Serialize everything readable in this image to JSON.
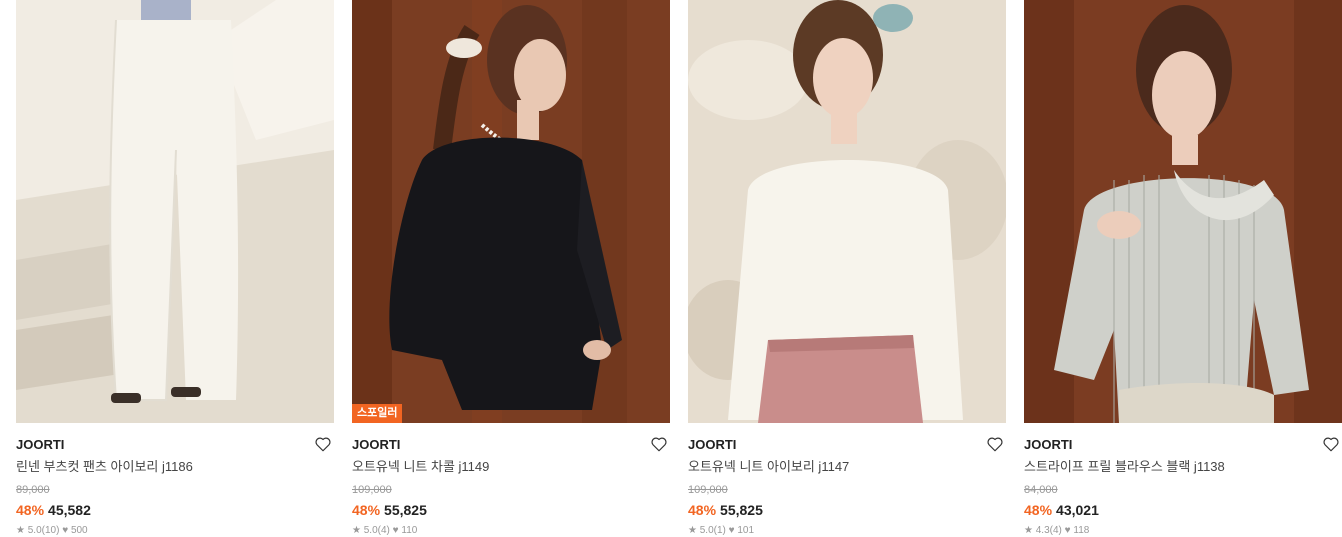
{
  "products": [
    {
      "brand": "JOORTI",
      "name": "린넨 부츠컷 팬츠 아이보리 j1186",
      "original_price": "89,000",
      "discount": "48%",
      "price": "45,582",
      "badge": "",
      "rating": "5.0(10)",
      "likes": "500"
    },
    {
      "brand": "JOORTI",
      "name": "오트유넥 니트 차콜 j1149",
      "original_price": "109,000",
      "discount": "48%",
      "price": "55,825",
      "badge": "스포일러",
      "rating": "5.0(4)",
      "likes": "110"
    },
    {
      "brand": "JOORTI",
      "name": "오트유넥 니트 아이보리 j1147",
      "original_price": "109,000",
      "discount": "48%",
      "price": "55,825",
      "badge": "",
      "rating": "5.0(1)",
      "likes": "101"
    },
    {
      "brand": "JOORTI",
      "name": "스트라이프 프릴 블라우스 블랙 j1138",
      "original_price": "84,000",
      "discount": "48%",
      "price": "43,021",
      "badge": "",
      "rating": "4.3(4)",
      "likes": "118"
    }
  ],
  "colors": {
    "accent": "#f26522",
    "brand_text": "#222222",
    "strike_text": "#999999"
  },
  "icons": {
    "like": "heart-outline-icon",
    "rating": "star-icon",
    "likes": "heart-filled-icon"
  }
}
